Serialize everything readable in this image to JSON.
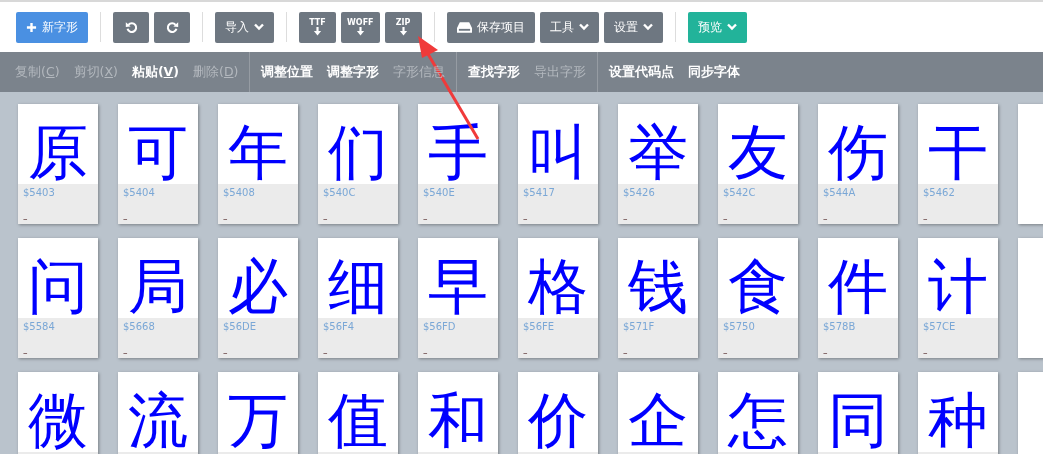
{
  "toolbar": {
    "groups": [
      {
        "buttons": [
          {
            "kind": "plus",
            "label": "新字形"
          }
        ]
      },
      {
        "buttons": [
          {
            "kind": "undo"
          },
          {
            "kind": "redo"
          }
        ]
      },
      {
        "buttons": [
          {
            "kind": "dropdown",
            "label": "导入"
          }
        ]
      },
      {
        "buttons": [
          {
            "kind": "download",
            "label": "TTF"
          },
          {
            "kind": "download",
            "label": "WOFF"
          },
          {
            "kind": "download",
            "label": "ZIP"
          }
        ]
      },
      {
        "buttons": [
          {
            "kind": "drive",
            "label": "保存项目"
          },
          {
            "kind": "dropdown",
            "label": "工具"
          },
          {
            "kind": "dropdown",
            "label": "设置"
          }
        ]
      },
      {
        "buttons": [
          {
            "kind": "dropdown",
            "label": "预览"
          }
        ]
      }
    ]
  },
  "action_bar": {
    "groups": [
      [
        {
          "label": "复制(",
          "accel": "C",
          "after": ")",
          "disabled": true
        },
        {
          "label": "剪切(",
          "accel": "X",
          "after": ")",
          "disabled": true
        },
        {
          "label": "粘贴(",
          "accel": "V",
          "after": ")",
          "disabled": false
        },
        {
          "label": "删除(",
          "accel": "D",
          "after": ")",
          "disabled": true
        }
      ],
      [
        {
          "label": "调整位置",
          "disabled": false
        },
        {
          "label": "调整字形",
          "disabled": false
        },
        {
          "label": "字形信息",
          "disabled": true
        }
      ],
      [
        {
          "label": "查找字形",
          "disabled": false
        },
        {
          "label": "导出字形",
          "disabled": true
        }
      ],
      [
        {
          "label": "设置代码点",
          "disabled": false
        },
        {
          "label": "同步字体",
          "disabled": false
        }
      ]
    ]
  },
  "glyphs": [
    {
      "char": "原",
      "code": "$5403",
      "name": "–"
    },
    {
      "char": "可",
      "code": "$5404",
      "name": "–"
    },
    {
      "char": "年",
      "code": "$5408",
      "name": "–"
    },
    {
      "char": "们",
      "code": "$540C",
      "name": "–"
    },
    {
      "char": "手",
      "code": "$540E",
      "name": "–"
    },
    {
      "char": "叫",
      "code": "$5417",
      "name": "–"
    },
    {
      "char": "举",
      "code": "$5426",
      "name": "–"
    },
    {
      "char": "友",
      "code": "$542C",
      "name": "–"
    },
    {
      "char": "伤",
      "code": "$544A",
      "name": "–"
    },
    {
      "char": "干",
      "code": "$5462",
      "name": "–"
    },
    {
      "char": "问",
      "code": "$5584",
      "name": "–"
    },
    {
      "char": "局",
      "code": "$5668",
      "name": "–"
    },
    {
      "char": "必",
      "code": "$56DE",
      "name": "–"
    },
    {
      "char": "细",
      "code": "$56F4",
      "name": "–"
    },
    {
      "char": "早",
      "code": "$56FD",
      "name": "–"
    },
    {
      "char": "格",
      "code": "$56FE",
      "name": "–"
    },
    {
      "char": "钱",
      "code": "$571F",
      "name": "–"
    },
    {
      "char": "食",
      "code": "$5750",
      "name": "–"
    },
    {
      "char": "件",
      "code": "$578B",
      "name": "–"
    },
    {
      "char": "计",
      "code": "$57CE",
      "name": "–"
    },
    {
      "char": "微"
    },
    {
      "char": "流"
    },
    {
      "char": "万"
    },
    {
      "char": "值"
    },
    {
      "char": "和"
    },
    {
      "char": "价"
    },
    {
      "char": "企"
    },
    {
      "char": "怎"
    },
    {
      "char": "同"
    },
    {
      "char": "种"
    }
  ]
}
